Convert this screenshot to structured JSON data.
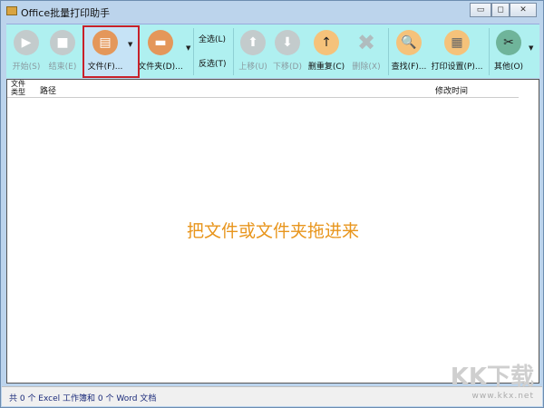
{
  "window": {
    "title": "Office批量打印助手",
    "minimize": "▭",
    "maximize": "◻",
    "close": "✕"
  },
  "toolbar": {
    "start": "开始(S)",
    "stop": "结束(E)",
    "file": "文件(F)...",
    "folder": "文件夹(D)...",
    "select_all": "全选(L)",
    "invert": "反选(T)",
    "move_up": "上移(U)",
    "move_down": "下移(D)",
    "dedupe": "删重复(C)",
    "delete": "删除(X)",
    "find": "查找(F)...",
    "print_settings": "打印设置(P)...",
    "other": "其他(O)"
  },
  "list": {
    "columns": [
      "文件类型",
      "路径",
      "修改时间"
    ],
    "empty_hint": "把文件或文件夹拖进来"
  },
  "status": "共 0 个 Excel 工作簿和 0 个 Word 文档",
  "watermark": {
    "logo": "KK下载",
    "url": "www.kkx.net"
  }
}
